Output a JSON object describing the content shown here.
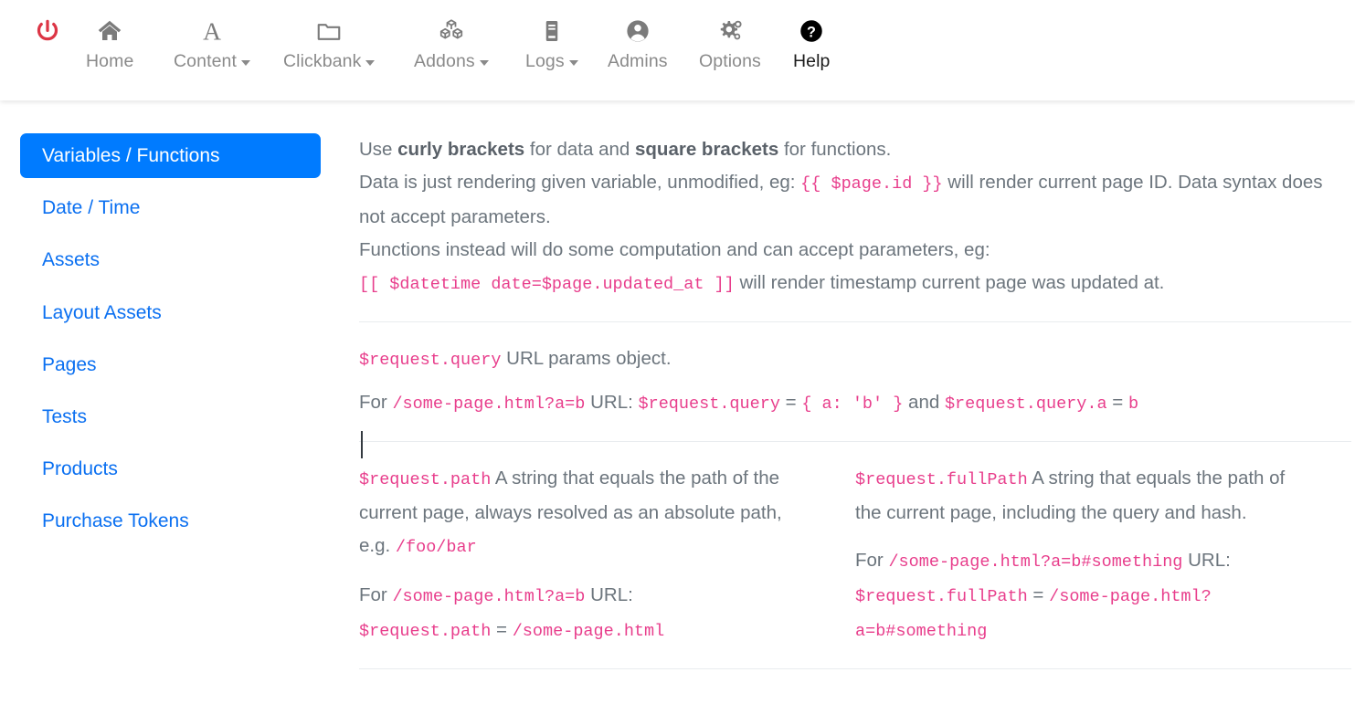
{
  "navbar": {
    "items": [
      {
        "name": "power",
        "label": "",
        "icon": "power-icon",
        "caret": false,
        "active": false
      },
      {
        "name": "home",
        "label": "Home",
        "icon": "home-icon",
        "caret": false,
        "active": false
      },
      {
        "name": "content",
        "label": "Content",
        "icon": "letter-a-icon",
        "caret": true,
        "active": false
      },
      {
        "name": "clickbank",
        "label": "Clickbank",
        "icon": "folder-icon",
        "caret": true,
        "active": false
      },
      {
        "name": "addons",
        "label": "Addons",
        "icon": "cubes-icon",
        "caret": true,
        "active": false
      },
      {
        "name": "logs",
        "label": "Logs",
        "icon": "book-icon",
        "caret": true,
        "active": false
      },
      {
        "name": "admins",
        "label": "Admins",
        "icon": "user-circle-icon",
        "caret": false,
        "active": false
      },
      {
        "name": "options",
        "label": "Options",
        "icon": "gears-icon",
        "caret": false,
        "active": false
      },
      {
        "name": "help",
        "label": "Help",
        "icon": "question-circle-icon",
        "caret": false,
        "active": true
      }
    ]
  },
  "sidebar": {
    "items": [
      {
        "label": "Variables / Functions",
        "active": true
      },
      {
        "label": "Date / Time",
        "active": false
      },
      {
        "label": "Assets",
        "active": false
      },
      {
        "label": "Layout Assets",
        "active": false
      },
      {
        "label": "Pages",
        "active": false
      },
      {
        "label": "Tests",
        "active": false
      },
      {
        "label": "Products",
        "active": false
      },
      {
        "label": "Purchase Tokens",
        "active": false
      }
    ]
  },
  "content": {
    "intro": {
      "line1_a": "Use ",
      "line1_b": "curly brackets",
      "line1_c": " for data and ",
      "line1_d": "square brackets",
      "line1_e": " for functions.",
      "line2_a": "Data is just rendering given variable, unmodified, eg: ",
      "line2_code": "{{ $page.id }}",
      "line2_b": " will render current page ID. Data syntax does not accept parameters.",
      "line3": "Functions instead will do some computation and can accept parameters, eg:",
      "line4_code": "[[ $datetime date=$page.updated_at ]]",
      "line4_b": " will render timestamp current page was updated at."
    },
    "query": {
      "token": "$request.query",
      "desc": " URL params object.",
      "ex_for": "For ",
      "ex_url": "/some-page.html?a=b",
      "ex_mid": " URL: ",
      "ex_token": "$request.query",
      "ex_eq": " = ",
      "ex_value": "{ a: 'b' }",
      "ex_and": " and ",
      "ex_token2": "$request.query.a",
      "ex_eq2": " = ",
      "ex_value2": "b"
    },
    "path": {
      "token": "$request.path",
      "desc_a": " A string that equals the path of the current page, always resolved as an absolute path, e.g. ",
      "desc_code": "/foo/bar",
      "ex_for": "For ",
      "ex_url": "/some-page.html?a=b",
      "ex_mid": " URL:",
      "res_token": "$request.path",
      "res_eq": " = ",
      "res_value": "/some-page.html"
    },
    "fullPath": {
      "token": "$request.fullPath",
      "desc_a": " A string that equals the path of the current page, including the query and hash.",
      "ex_for": "For ",
      "ex_url": "/some-page.html?a=b#something",
      "ex_mid": " URL:",
      "res_token": "$request.fullPath",
      "res_eq": " = ",
      "res_value": "/some-page.html?a=b#something"
    }
  },
  "colors": {
    "accent_blue": "#007bff",
    "link_blue": "#0b70f1",
    "code_pink": "#e83e8c",
    "text_gray": "#6c757d",
    "power_red": "#dc3545"
  }
}
